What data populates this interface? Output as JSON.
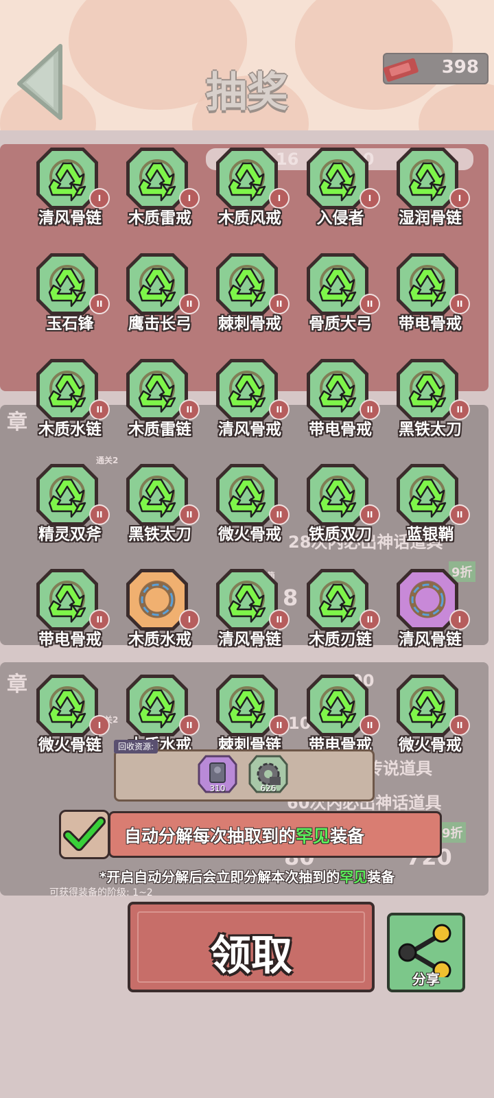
{
  "header": {
    "title": "抽奖",
    "currency_value": "398"
  },
  "items": [
    {
      "name": "清风骨链",
      "level": "I"
    },
    {
      "name": "木质雷戒",
      "level": "I"
    },
    {
      "name": "木质风戒",
      "level": "I"
    },
    {
      "name": "入侵者",
      "level": "I"
    },
    {
      "name": "湿润骨链",
      "level": "I"
    },
    {
      "name": "玉石锋",
      "level": "II"
    },
    {
      "name": "鹰击长弓",
      "level": "II"
    },
    {
      "name": "棘刺骨戒",
      "level": "II"
    },
    {
      "name": "骨质大弓",
      "level": "II"
    },
    {
      "name": "带电骨戒",
      "level": "II"
    },
    {
      "name": "木质水链",
      "level": "II"
    },
    {
      "name": "木质雷链",
      "level": "II"
    },
    {
      "name": "清风骨戒",
      "level": "II"
    },
    {
      "name": "带电骨戒",
      "level": "II"
    },
    {
      "name": "黑铁太刀",
      "level": "II"
    },
    {
      "name": "精灵双斧",
      "level": "II"
    },
    {
      "name": "黑铁太刀",
      "level": "II"
    },
    {
      "name": "微火骨戒",
      "level": "II"
    },
    {
      "name": "铁质双刀",
      "level": "II"
    },
    {
      "name": "蓝银鞘",
      "level": "II"
    },
    {
      "name": "带电骨戒",
      "level": "II"
    },
    {
      "name": "木质水戒",
      "level": "I"
    },
    {
      "name": "清风骨链",
      "level": "II"
    },
    {
      "name": "木质刃链",
      "level": "II"
    },
    {
      "name": "清风骨链",
      "level": "I"
    },
    {
      "name": "微火骨链",
      "level": "I"
    },
    {
      "name": "木质水戒",
      "level": "II"
    },
    {
      "name": "棘刺骨链",
      "level": "II"
    },
    {
      "name": "带电骨戒",
      "level": "II"
    },
    {
      "name": "微火骨戒",
      "level": "II"
    }
  ],
  "recycle": {
    "label": "回收资源:",
    "resources": [
      {
        "name": "stone",
        "count": "310"
      },
      {
        "name": "gear",
        "count": "626"
      }
    ]
  },
  "auto": {
    "text_before": "自动分解每次抽取到的",
    "highlight": "罕见",
    "text_after": "装备",
    "note_before": "*开启自动分解后会立即分解本次抽到的",
    "note_highlight": "罕见",
    "note_after": "装备",
    "stage_text": "可获得装备的阶级: 1~2"
  },
  "buttons": {
    "claim": "领取",
    "share": "分享"
  },
  "background": {
    "timer_1": "16",
    "timer_1b": "00",
    "timer_2": "00",
    "count_1": "28次内必出神话道具",
    "line_a": "出传说道具",
    "line_b": "60次内必出神话道具",
    "discount_1": "9折",
    "discount_2": "9折",
    "chapter_1": "章",
    "chapter_2": "章",
    "pass_1": "通关2",
    "pass_2": "通关2",
    "box_label": "购取1箱",
    "num_80": "80",
    "num_720": "720",
    "num_8": "8",
    "num_10": "10"
  },
  "colors": {
    "card_green": "#8ccf95",
    "card_orange": "#f0b070",
    "card_purple": "#c889d8",
    "accent_green": "#5cf05c",
    "level_badge": "#b65d5d"
  }
}
